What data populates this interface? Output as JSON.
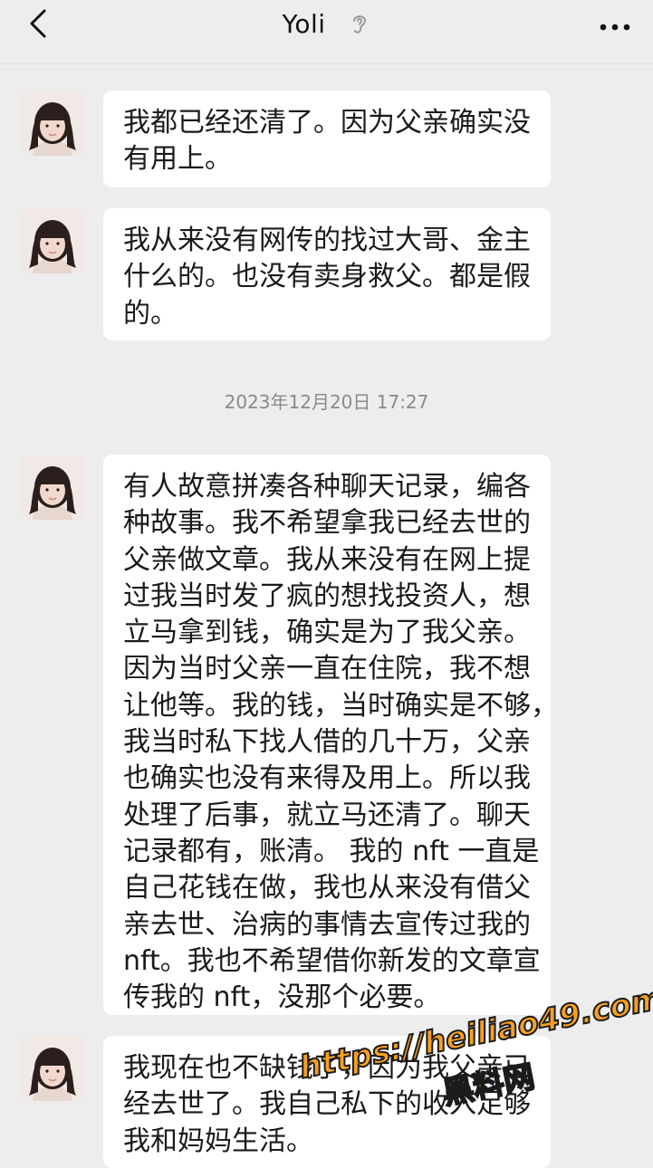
{
  "header": {
    "title": "Yoli",
    "back_icon": "chevron-left-icon",
    "ear_icon": "ear-icon",
    "more_icon": "more-dots-icon"
  },
  "messages": [
    {
      "sender": "Yoli",
      "lines": [
        "我都已经还清了。因为父亲确实没",
        "有用上。"
      ]
    },
    {
      "sender": "Yoli",
      "lines": [
        "我从来没有网传的找过大哥、金主",
        "什么的。也没有卖身救父。都是假",
        "的。"
      ]
    },
    {
      "sender": "Yoli",
      "lines": [
        "有人故意拼凑各种聊天记录，编各",
        "种故事。我不希望拿我已经去世的",
        "父亲做文章。我从来没有在网上提",
        "过我当时发了疯的想找投资人，想",
        "立马拿到钱，确实是为了我父亲。",
        "因为当时父亲一直在住院，我不想",
        "让他等。我的钱，当时确实是不够，",
        "我当时私下找人借的几十万，父亲",
        "也确实也没有来得及用上。所以我",
        "处理了后事，就立马还清了。聊天",
        "记录都有，账清。 我的 nft 一直是",
        "自己花钱在做，我也从来没有借父",
        "亲去世、治病的事情去宣传过我的",
        "nft。我也不希望借你新发的文章宣",
        "传我的 nft，没那个必要。"
      ]
    },
    {
      "sender": "Yoli",
      "lines": [
        "我现在也不缺钱了，因为我父亲已",
        "经去世了。我自己私下的收入足够",
        "我和妈妈生活。"
      ]
    }
  ],
  "timestamp": "2023年12月20日 17:27",
  "watermark": {
    "url": "https://heiliao49.com",
    "name": "黑料网"
  },
  "colors": {
    "background": "#ededed",
    "bubble": "#ffffff",
    "timestamp": "#8a8a8a",
    "watermark": "#f7a021"
  }
}
